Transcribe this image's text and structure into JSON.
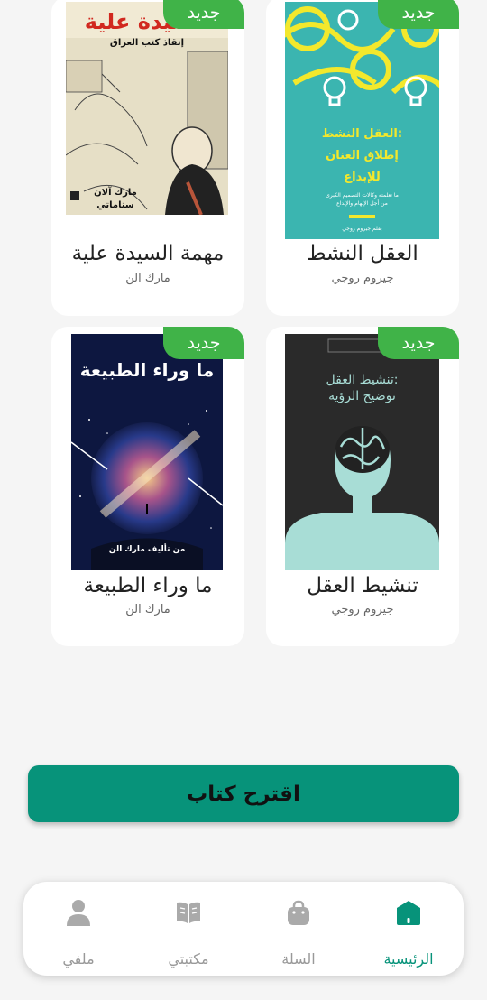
{
  "books": [
    {
      "badge": "جديد",
      "title": "العقل النشط",
      "author": "جيروم روجي",
      "cover": {
        "title_line1": "العقل النشط:",
        "title_line2": "إطلاق العنان",
        "title_line3": "للإبداع",
        "subtitle_line1": "ما تعلمته وكالات التصميم الكبرى",
        "subtitle_line2": "من أجل الإلهام والإبداع",
        "author": "بقلم جيروم روجي"
      }
    },
    {
      "badge": "جديد",
      "title": "مهمة السيدة علية",
      "author": "مارك الن",
      "cover": {
        "title": "السيدة علية",
        "subtitle": "إنقاذ كتب العراق",
        "author_line1": "مارك آلان",
        "author_line2": "ستاماتي"
      }
    },
    {
      "badge": "جديد",
      "title": "تنشيط العقل",
      "author": "جيروم روجي",
      "cover": {
        "title_line1": "تنشيط العقل:",
        "title_line2": "توضيح الرؤية"
      }
    },
    {
      "badge": "جديد",
      "title": "ما وراء الطبيعة",
      "author": "مارك الن",
      "cover": {
        "title": "ما وراء الطبيعة",
        "byline": "من تأليف مارك الن"
      }
    }
  ],
  "suggest_button": "اقترح كتاب",
  "nav": {
    "home": "الرئيسية",
    "cart": "السلة",
    "library": "مكتبتي",
    "profile": "ملفي"
  },
  "colors": {
    "accent": "#07937a",
    "badge": "#40b348",
    "cover1_bg": "#3bb5b0",
    "cover1_fg": "#f3e82c",
    "cover3_bg": "#2a2a2a",
    "cover3_fg": "#a8ddd6"
  }
}
